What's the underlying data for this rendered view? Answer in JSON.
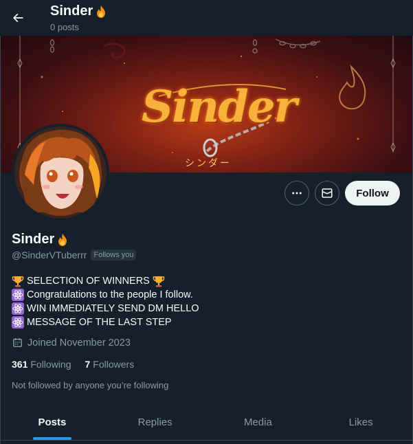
{
  "header": {
    "title": "Sinder",
    "title_icon": "fire-emoji",
    "post_count": "0 posts",
    "back_icon": "arrow-left-icon"
  },
  "banner": {
    "logo_text": "Sinder",
    "logo_subtext": "シンダー"
  },
  "actions": {
    "more_icon": "more-dots-icon",
    "message_icon": "envelope-icon",
    "follow_label": "Follow"
  },
  "profile": {
    "name": "Sinder",
    "name_icon": "fire-emoji",
    "handle": "@SinderVTuberrr",
    "follows_you": "Follows you",
    "bio": [
      {
        "icons": [
          "trophy-emoji"
        ],
        "text": "SELECTION OF WINNERS",
        "trailing_icon": "trophy-emoji"
      },
      {
        "icons": [
          "atom-emoji"
        ],
        "text": "Congratulations to the people I follow."
      },
      {
        "icons": [
          "atom-emoji"
        ],
        "text": "WIN IMMEDIATELY SEND DM HELLO"
      },
      {
        "icons": [
          "atom-emoji"
        ],
        "text": "MESSAGE OF THE LAST STEP"
      }
    ],
    "joined": "Joined November 2023",
    "following_count": "361",
    "following_label": "Following",
    "followers_count": "7",
    "followers_label": "Followers",
    "not_followed": "Not followed by anyone you’re following"
  },
  "tabs": [
    {
      "label": "Posts",
      "active": true
    },
    {
      "label": "Replies",
      "active": false
    },
    {
      "label": "Media",
      "active": false
    },
    {
      "label": "Likes",
      "active": false
    }
  ],
  "colors": {
    "background": "#15202b",
    "accent": "#1d9bf0",
    "secondary_text": "#8b98a5"
  }
}
